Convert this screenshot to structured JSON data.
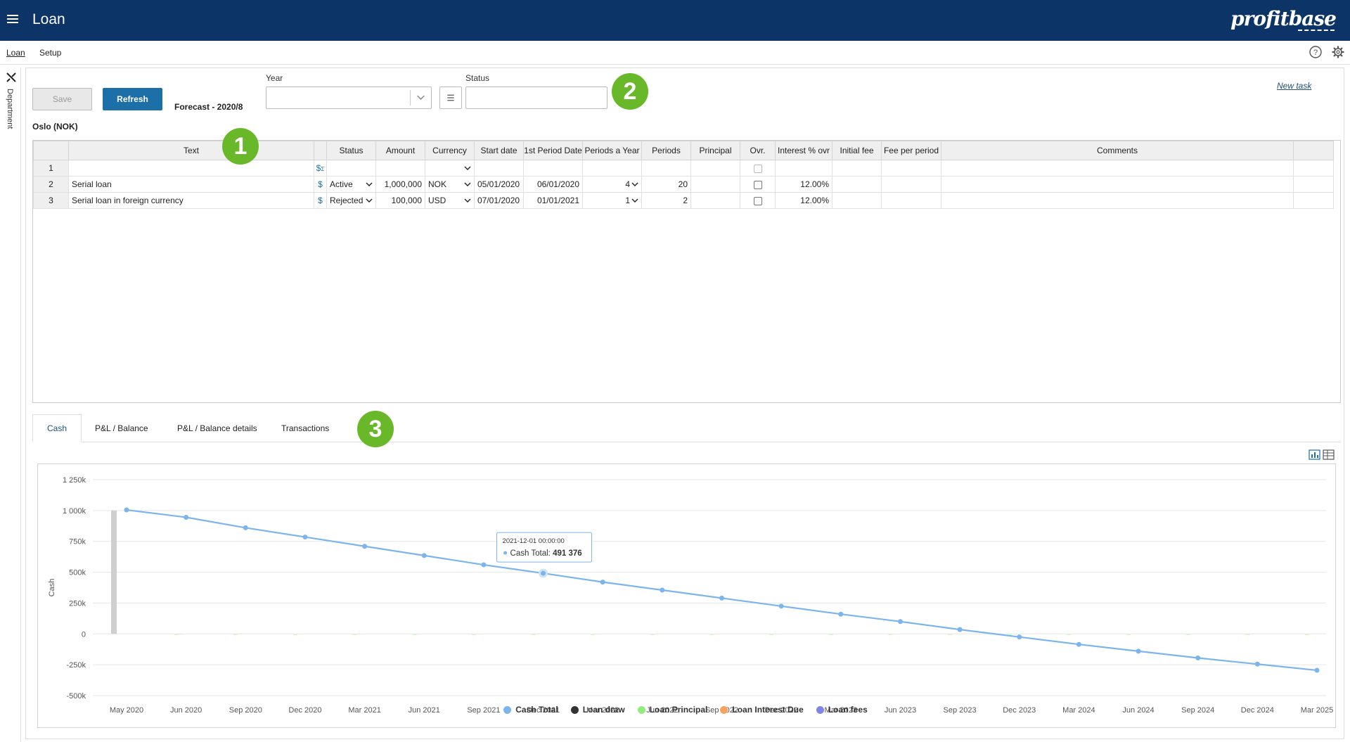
{
  "header": {
    "title": "Loan",
    "logo": "profitbase"
  },
  "subnav": {
    "tabs": [
      "Loan",
      "Setup"
    ],
    "active": "Loan"
  },
  "rail": {
    "label": "Department"
  },
  "toolbar": {
    "save_label": "Save",
    "refresh_label": "Refresh",
    "forecast": "Forecast - 2020/8",
    "year_label": "Year",
    "year_value": "",
    "status_label": "Status",
    "status_value": "",
    "new_task": "New task"
  },
  "badges": [
    "1",
    "2",
    "3"
  ],
  "department": "Oslo (NOK)",
  "grid": {
    "columns": [
      "Text",
      "",
      "Status",
      "Amount",
      "Currency",
      "Start date",
      "1st Period Date",
      "Periods a Year",
      "Periods",
      "Principal",
      "Ovr.",
      "Interest % ovr",
      "Initial fee",
      "Fee per period",
      "Comments"
    ],
    "rows": [
      {
        "n": "1",
        "text": "",
        "status": "",
        "amount": "",
        "currency": "",
        "start": "",
        "first": "",
        "ppy": "",
        "periods": "",
        "principal": "",
        "interest": "",
        "initial": "",
        "fee": "",
        "comments": ""
      },
      {
        "n": "2",
        "text": "Serial loan",
        "status": "Active",
        "amount": "1,000,000",
        "currency": "NOK",
        "start": "05/01/2020",
        "first": "06/01/2020",
        "ppy": "4",
        "periods": "20",
        "principal": "",
        "interest": "12.00%",
        "initial": "",
        "fee": "",
        "comments": ""
      },
      {
        "n": "3",
        "text": "Serial loan in foreign currency",
        "status": "Rejected",
        "amount": "100,000",
        "currency": "USD",
        "start": "07/01/2020",
        "first": "01/01/2021",
        "ppy": "1",
        "periods": "2",
        "principal": "",
        "interest": "12.00%",
        "initial": "",
        "fee": "",
        "comments": ""
      }
    ]
  },
  "bottom_tabs": [
    "Cash",
    "P&L / Balance",
    "P&L / Balance details",
    "Transactions"
  ],
  "tooltip": {
    "date": "2021-12-01 00:00:00",
    "series": "Cash Total",
    "value": "491 376"
  },
  "chart_data": {
    "type": "line",
    "ylabel": "Cash",
    "yticks": [
      "1 250k",
      "1 000k",
      "750k",
      "500k",
      "250k",
      "0",
      "-250k",
      "-500k"
    ],
    "ylim": [
      -500000,
      1250000
    ],
    "categories": [
      "May 2020",
      "Jun 2020",
      "Sep 2020",
      "Dec 2020",
      "Mar 2021",
      "Jun 2021",
      "Sep 2021",
      "Dec 2021",
      "Mar 2022",
      "Jun 2022",
      "Sep 2022",
      "Dec 2022",
      "Mar 2023",
      "Jun 2023",
      "Sep 2023",
      "Dec 2023",
      "Mar 2024",
      "Jun 2024",
      "Sep 2024",
      "Dec 2024",
      "Mar 2025"
    ],
    "series": [
      {
        "name": "Cash Total",
        "color": "#7cb5ec",
        "values": [
          1005000,
          945000,
          860000,
          785000,
          710000,
          635000,
          560000,
          491376,
          420000,
          355000,
          290000,
          225000,
          160000,
          100000,
          35000,
          -25000,
          -85000,
          -140000,
          -195000,
          -245000,
          -295000
        ]
      },
      {
        "name": "Loan draw",
        "color": "#333333",
        "values": [
          1000000,
          0,
          0,
          0,
          0,
          0,
          0,
          0,
          0,
          0,
          0,
          0,
          0,
          0,
          0,
          0,
          0,
          0,
          0,
          0,
          0
        ]
      },
      {
        "name": "Loan Principal",
        "color": "#90ed7d",
        "values": [
          0,
          -50000,
          -50000,
          -50000,
          -50000,
          -50000,
          -50000,
          -50000,
          -50000,
          -50000,
          -50000,
          -50000,
          -50000,
          -50000,
          -50000,
          -50000,
          -50000,
          -50000,
          -50000,
          -50000,
          -50000
        ]
      },
      {
        "name": "Loan Interest Due",
        "color": "#f7a35c",
        "values": [
          0,
          -30000,
          -28500,
          -27000,
          -25500,
          -24000,
          -22500,
          -21000,
          -19500,
          -18000,
          -16500,
          -15000,
          -13500,
          -12000,
          -10500,
          -9000,
          -7500,
          -6000,
          -4500,
          -3000,
          -1500
        ]
      },
      {
        "name": "Loan fees",
        "color": "#8085e9",
        "values": [
          0,
          0,
          0,
          0,
          0,
          0,
          0,
          0,
          0,
          0,
          0,
          0,
          0,
          0,
          0,
          0,
          0,
          0,
          0,
          0,
          0
        ]
      }
    ]
  }
}
